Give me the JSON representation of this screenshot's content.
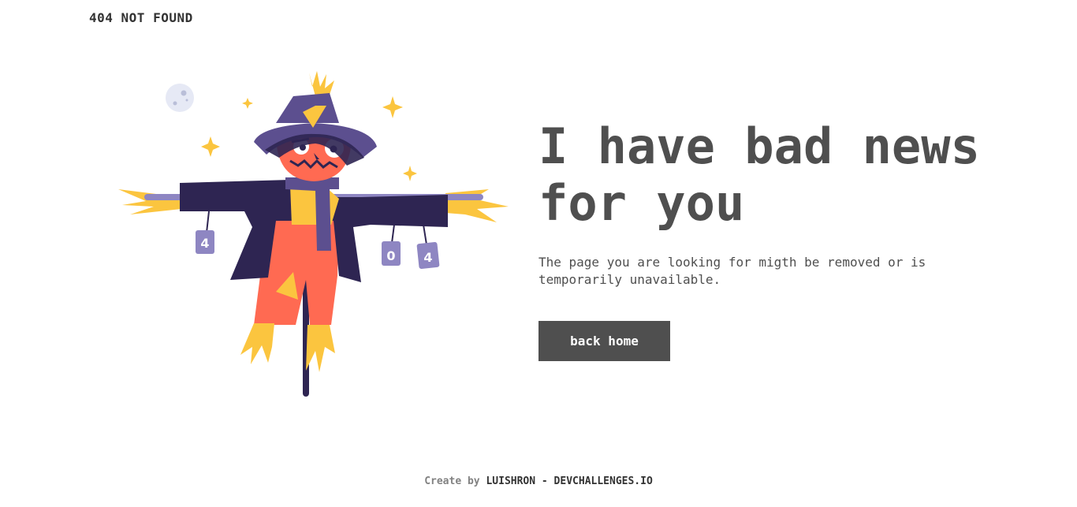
{
  "header": {
    "brand": "404 NOT FOUND"
  },
  "main": {
    "headline": "I have bad news for you",
    "message": "The page you are looking for migth be removed or is temporarily unavailable.",
    "button_label": "back home"
  },
  "footer": {
    "prefix": "Create by",
    "author": "LUISHRON - DEVCHALLENGES.IO"
  },
  "illustration": {
    "subject": "scarecrow",
    "can_labels": [
      "4",
      "0",
      "4"
    ]
  },
  "colors": {
    "text_dark": "#4f4f4f",
    "button_bg": "#4f4f4f",
    "hat_purple": "#5c4f8f",
    "coat_navy": "#2e2552",
    "pumpkin_orange": "#ff6a52",
    "straw_yellow": "#fbc53f"
  }
}
